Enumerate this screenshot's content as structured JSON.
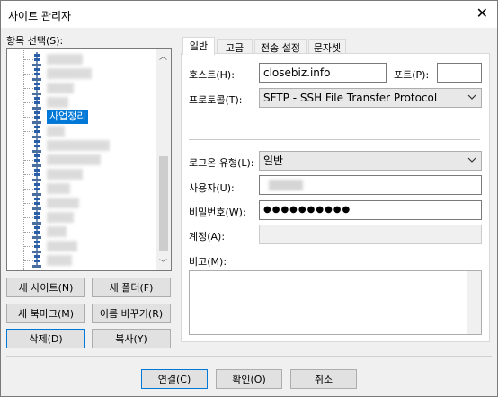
{
  "window": {
    "title": "사이트 관리자",
    "close_symbol": "✕"
  },
  "tree": {
    "label": "항목 선택(S):",
    "selected_item": "사업정리"
  },
  "left_buttons": {
    "new_site": "새 사이트(N)",
    "new_folder": "새 폴더(F)",
    "new_bookmark": "새 북마크(M)",
    "rename": "이름 바꾸기(R)",
    "delete": "삭제(D)",
    "copy": "복사(Y)"
  },
  "tabs": [
    "일반",
    "고급",
    "전송 설정",
    "문자셋"
  ],
  "general": {
    "host_label": "호스트(H):",
    "host_value": "closebiz.info",
    "port_label": "포트(P):",
    "port_value": "",
    "protocol_label": "프로토콜(T):",
    "protocol_value": "SFTP - SSH File Transfer Protocol",
    "logon_label": "로그온 유형(L):",
    "logon_value": "일반",
    "user_label": "사용자(U):",
    "user_value": "",
    "password_label": "비밀번호(W):",
    "password_value": "●●●●●●●●●●",
    "account_label": "계정(A):",
    "account_value": "",
    "comment_label": "비고(M):"
  },
  "footer": {
    "connect": "연결(C)",
    "ok": "확인(O)",
    "cancel": "취소"
  }
}
